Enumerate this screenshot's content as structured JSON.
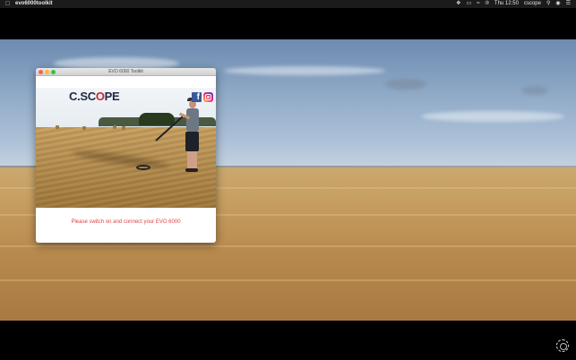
{
  "menubar": {
    "app_name": "evo6000toolkit",
    "time": "Thu 12:50",
    "user": "cscope",
    "icons": [
      "dropbox-icon",
      "airplay-icon",
      "wifi-icon",
      "bluetooth-icon",
      "clock-icon",
      "user-icon",
      "search-icon",
      "siri-icon",
      "notification-center-icon"
    ]
  },
  "window": {
    "title": "EVO 6000 Toolkit",
    "logo_text_before": "C.SC",
    "logo_text_o": "O",
    "logo_text_after": "PE",
    "facebook_label": "f",
    "status_message": "Please switch on and connect your EVO 6000"
  },
  "colors": {
    "status_text": "#e24141",
    "logo_navy": "#1f2a44",
    "logo_red": "#c62631",
    "facebook_blue": "#3b5998"
  }
}
